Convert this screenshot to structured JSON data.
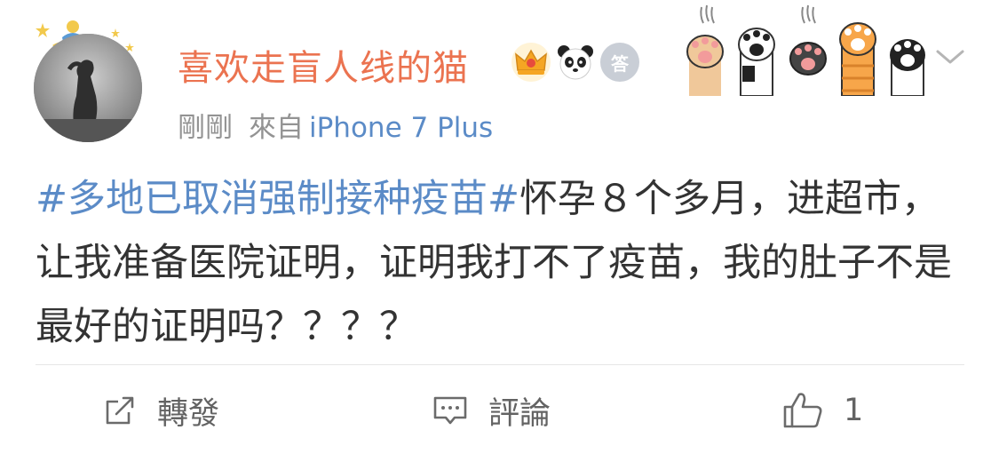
{
  "post": {
    "username": "喜欢走盲人线的猫",
    "time": "剛剛",
    "source_prefix": "來自",
    "source_device": "iPhone 7 Plus",
    "topic": "#多地已取消强制接种疫苗#",
    "text": "怀孕８个多月，进超市，让我准备医院证明，证明我打不了疫苗，我的肚子不是最好的证明吗？？？？",
    "badge_medal_text": "答"
  },
  "actions": {
    "repost_label": "轉發",
    "comment_label": "評論",
    "like_count": "1"
  },
  "colors": {
    "username": "#eb7350",
    "link": "#5b8bc7",
    "meta": "#939393",
    "body_text": "#333333",
    "action_text": "#636363"
  },
  "icons": [
    "avatar",
    "prince-decoration",
    "crown-badge-icon",
    "panda-badge-icon",
    "medal-badge-icon",
    "cat-paws-decoration",
    "chevron-down-icon",
    "repost-icon",
    "comment-icon",
    "like-icon"
  ]
}
